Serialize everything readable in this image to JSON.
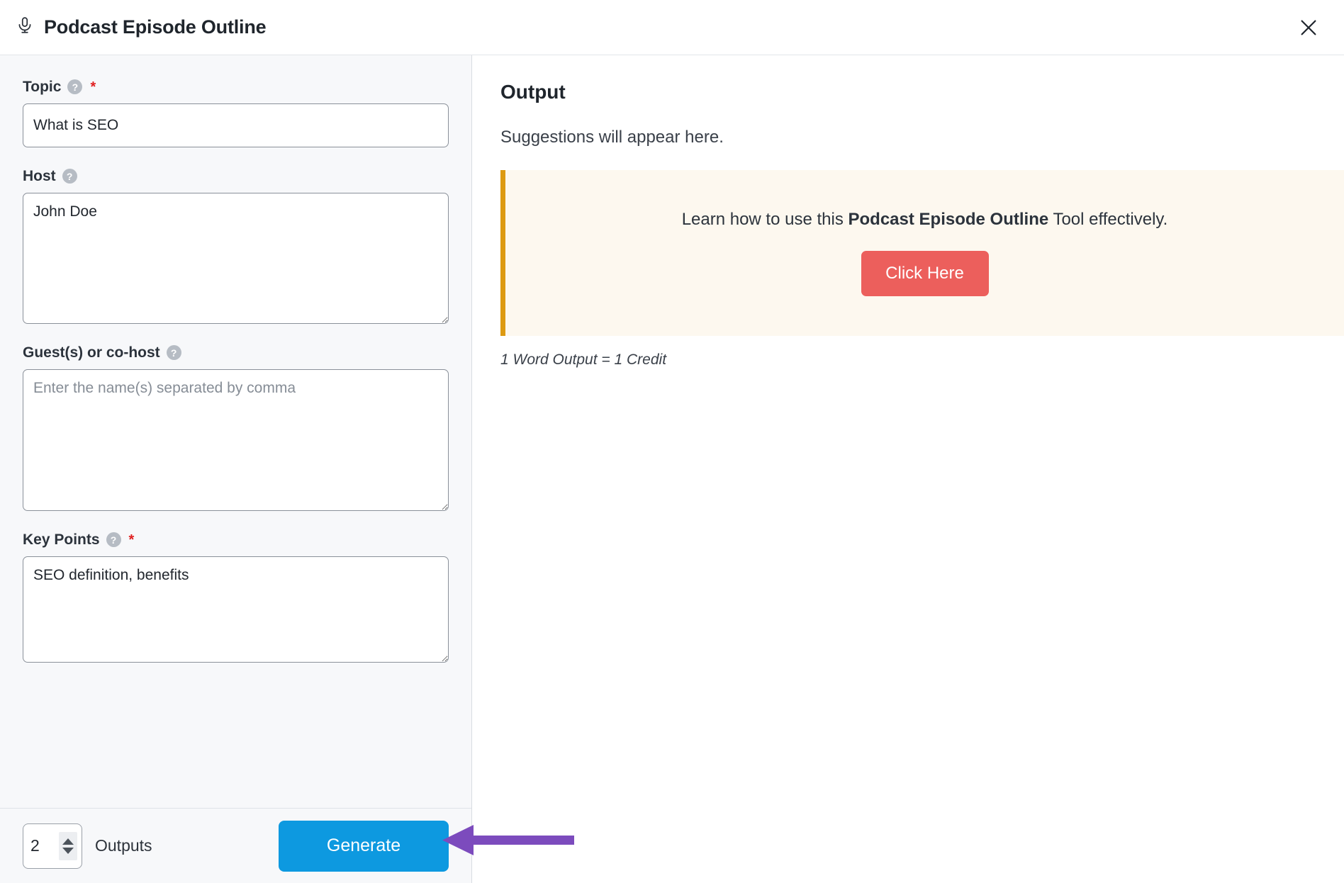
{
  "header": {
    "icon": "microphone-icon",
    "title": "Podcast Episode Outline",
    "close_icon": "close-icon"
  },
  "form": {
    "fields": [
      {
        "label": "Topic",
        "help_icon": "?",
        "required_mark": "*",
        "required": true,
        "type": "input",
        "value": "What is SEO",
        "placeholder": ""
      },
      {
        "label": "Host",
        "help_icon": "?",
        "required_mark": "",
        "required": false,
        "type": "textarea",
        "value": "John Doe",
        "placeholder": ""
      },
      {
        "label": "Guest(s) or co-host",
        "help_icon": "?",
        "required_mark": "",
        "required": false,
        "type": "textarea",
        "value": "",
        "placeholder": "Enter the name(s) separated by comma"
      },
      {
        "label": "Key Points",
        "help_icon": "?",
        "required_mark": "*",
        "required": true,
        "type": "textarea",
        "value": "SEO definition, benefits",
        "placeholder": ""
      }
    ]
  },
  "footer": {
    "outputs_count": "2",
    "outputs_label": "Outputs",
    "generate_label": "Generate",
    "stepper_up_icon": "chevron-up-icon",
    "stepper_down_icon": "chevron-down-icon"
  },
  "output": {
    "title": "Output",
    "placeholder_text": "Suggestions will appear here.",
    "banner": {
      "text_before": "Learn how to use this ",
      "text_bold": "Podcast Episode Outline",
      "text_after": " Tool effectively.",
      "button_label": "Click Here"
    },
    "credit_note": "1 Word Output = 1 Credit"
  },
  "annotation": {
    "arrow": "left-pointing-arrow",
    "target": "generate-button"
  },
  "colors": {
    "accent_blue": "#0d99e0",
    "banner_bg": "#fdf8ef",
    "banner_border": "#dd9a12",
    "click_here_red": "#ec5f5c",
    "required_red": "#e02020",
    "panel_bg": "#f7f8fa",
    "annotation_purple": "#7c4bbd"
  }
}
